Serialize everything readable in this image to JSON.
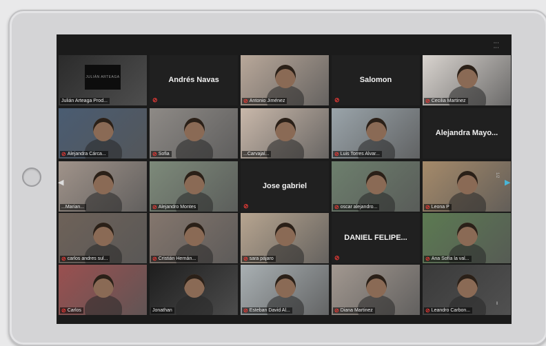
{
  "meeting": {
    "participants": [
      {
        "label": "Julián Arteaga Prod...",
        "video": true,
        "active": true,
        "muted": false,
        "bg": "#2b2b2b",
        "logo": true
      },
      {
        "name": "Andrés Navas",
        "video": false,
        "muted": true
      },
      {
        "label": "Antonio Jiménez",
        "video": true,
        "muted": true,
        "bg": "#b9a89a"
      },
      {
        "name": "Salomon",
        "video": false,
        "muted": true
      },
      {
        "label": "Cecilia Martinez",
        "video": true,
        "muted": true,
        "bg": "#d9d4cf"
      },
      {
        "label": "Alejandra Cárca...",
        "video": true,
        "muted": true,
        "bg": "#4a5c72"
      },
      {
        "label": "Sofia",
        "video": true,
        "muted": true,
        "bg": "#8e8a86"
      },
      {
        "label": "...Carvajal...",
        "video": true,
        "muted": false,
        "bg": "#c9b8aa"
      },
      {
        "label": "Luis Torres Alvar...",
        "video": true,
        "muted": true,
        "bg": "#9aa4aa"
      },
      {
        "name": "Alejandra Mayo...",
        "video": false,
        "muted": false
      },
      {
        "label": "...Marian...",
        "video": true,
        "muted": false,
        "bg": "#a0938a"
      },
      {
        "label": "Alejandro Montes",
        "video": true,
        "muted": true,
        "bg": "#7d8a7a"
      },
      {
        "name": "Jose gabriel",
        "video": false,
        "muted": true
      },
      {
        "label": "oscar alejandro...",
        "video": true,
        "muted": true,
        "bg": "#6d7f6d"
      },
      {
        "label": "Leona P",
        "video": true,
        "muted": true,
        "bg": "#a58a6a"
      },
      {
        "label": "carlos andres sul...",
        "video": true,
        "muted": true,
        "bg": "#6e6259"
      },
      {
        "label": "Cristián Hernán...",
        "video": true,
        "muted": true,
        "bg": "#84766d"
      },
      {
        "label": "sara pájaro",
        "video": true,
        "muted": true,
        "bg": "#b7a590"
      },
      {
        "name": "DANIEL FELIPE...",
        "video": false,
        "muted": true
      },
      {
        "label": "Ana Sofía la val...",
        "video": true,
        "muted": true,
        "bg": "#5c7a52"
      },
      {
        "label": "Carlos",
        "video": true,
        "muted": true,
        "bg": "#9a5050"
      },
      {
        "label": "Jonathan",
        "video": true,
        "muted": false,
        "bg": "#1e1e1e"
      },
      {
        "label": "Esteban David Al...",
        "video": true,
        "muted": true,
        "bg": "#a9b0b3"
      },
      {
        "label": "Diana Martinez",
        "video": true,
        "muted": true,
        "bg": "#a29890"
      },
      {
        "label": "Leandro Carbon...",
        "video": true,
        "muted": true,
        "bg": "#3a3a3a"
      }
    ],
    "logo_text": "JULIÁN ARTEAGA",
    "page_left_icon": "chevron-left-icon",
    "page_right_icon": "chevron-right-icon"
  }
}
